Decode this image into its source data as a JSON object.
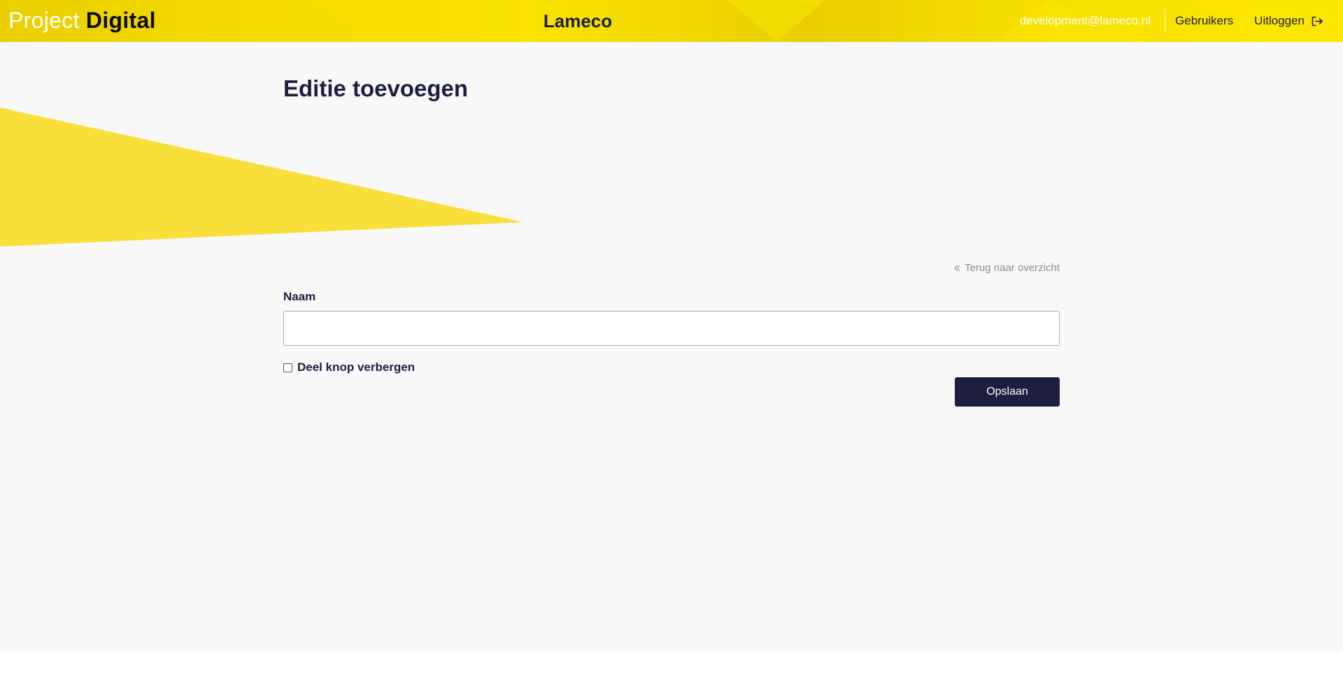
{
  "header": {
    "brand_light": "Project",
    "brand_bold": "Digital",
    "app_title": "Lameco",
    "user_email": "development@lameco.nl",
    "nav_users": "Gebruikers",
    "nav_logout": "Uitloggen",
    "logout_icon": "sign-out-icon"
  },
  "page": {
    "title": "Editie toevoegen",
    "back_link": "Terug naar overzicht",
    "back_icon": "double-chevron-left-icon"
  },
  "form": {
    "name_label": "Naam",
    "name_value": "",
    "name_placeholder": "",
    "hide_share_label": "Deel knop verbergen",
    "hide_share_checked": false,
    "save_label": "Opslaan"
  },
  "colors": {
    "brand_yellow": "#f5dd00",
    "accent_navy": "#1e1e3f",
    "deco_yellow": "#f8df3a",
    "page_bg": "#f8f8f8"
  }
}
